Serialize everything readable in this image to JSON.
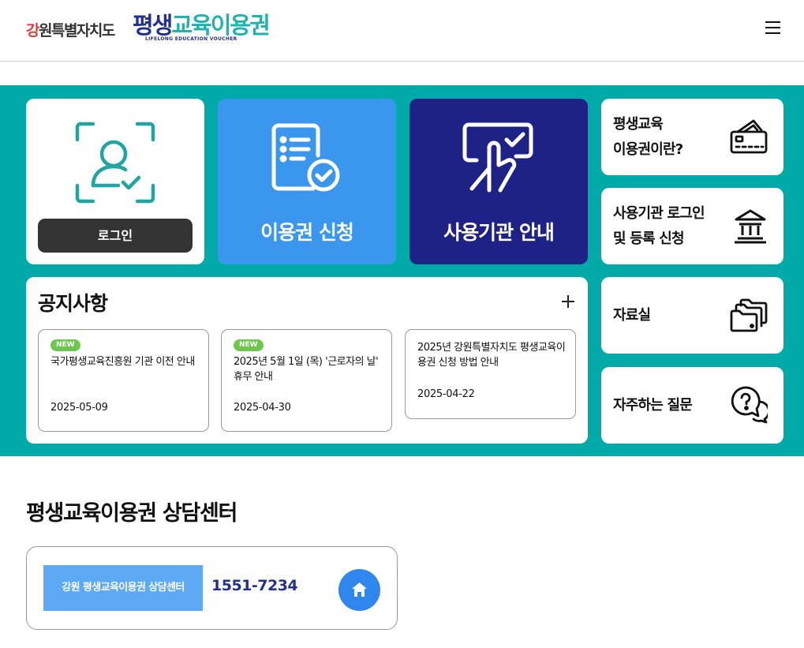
{
  "header": {
    "org_logo_red": "강",
    "org_logo_rest": "원특별자치도",
    "voucher_logo_prefix": "평생",
    "voucher_logo_rest": "교육이용권",
    "voucher_logo_sub": "LIFELONG EDUCATION VOUCHER",
    "menu_icon": "hamburger-icon"
  },
  "quick_menu": {
    "login": {
      "label": "로그인",
      "icon": "face-scan-user-icon"
    },
    "apply": {
      "label": "이용권 신청",
      "icon": "document-check-icon"
    },
    "institutions": {
      "label": "사용기관 안내",
      "icon": "touch-screen-check-icon"
    }
  },
  "side_menu": [
    {
      "label": "평생교육\n이용권이란?",
      "icon": "voucher-card-icon"
    },
    {
      "label": "사용기관 로그인\n및 등록 신청",
      "icon": "institution-building-icon"
    },
    {
      "label": "자료실",
      "icon": "folders-icon"
    },
    {
      "label": "자주하는 질문",
      "icon": "question-chat-icon"
    }
  ],
  "notices": {
    "title": "공지사항",
    "more_icon": "plus-icon",
    "items": [
      {
        "badge": "NEW",
        "title": "국가평생교육진흥원 기관 이전 안내",
        "date": "2025-05-09"
      },
      {
        "badge": "NEW",
        "title": "2025년 5월 1일 (목) '근로자의 날' 휴무 안내",
        "date": "2025-04-30"
      },
      {
        "badge": "",
        "title": "2025년 강원특별자치도 평생교육이용권 신청 방법 안내",
        "date": "2025-04-22"
      }
    ]
  },
  "counsel": {
    "title": "평생교육이용권 상담센터",
    "center_name": "강원 평생교육이용권 상담센터",
    "phone": "1551-7234",
    "home_icon": "home-icon"
  },
  "colors": {
    "teal": "#00aaa8",
    "blue": "#3b97ee",
    "navy": "#1e2286",
    "badge_green": "#6cc84a"
  }
}
